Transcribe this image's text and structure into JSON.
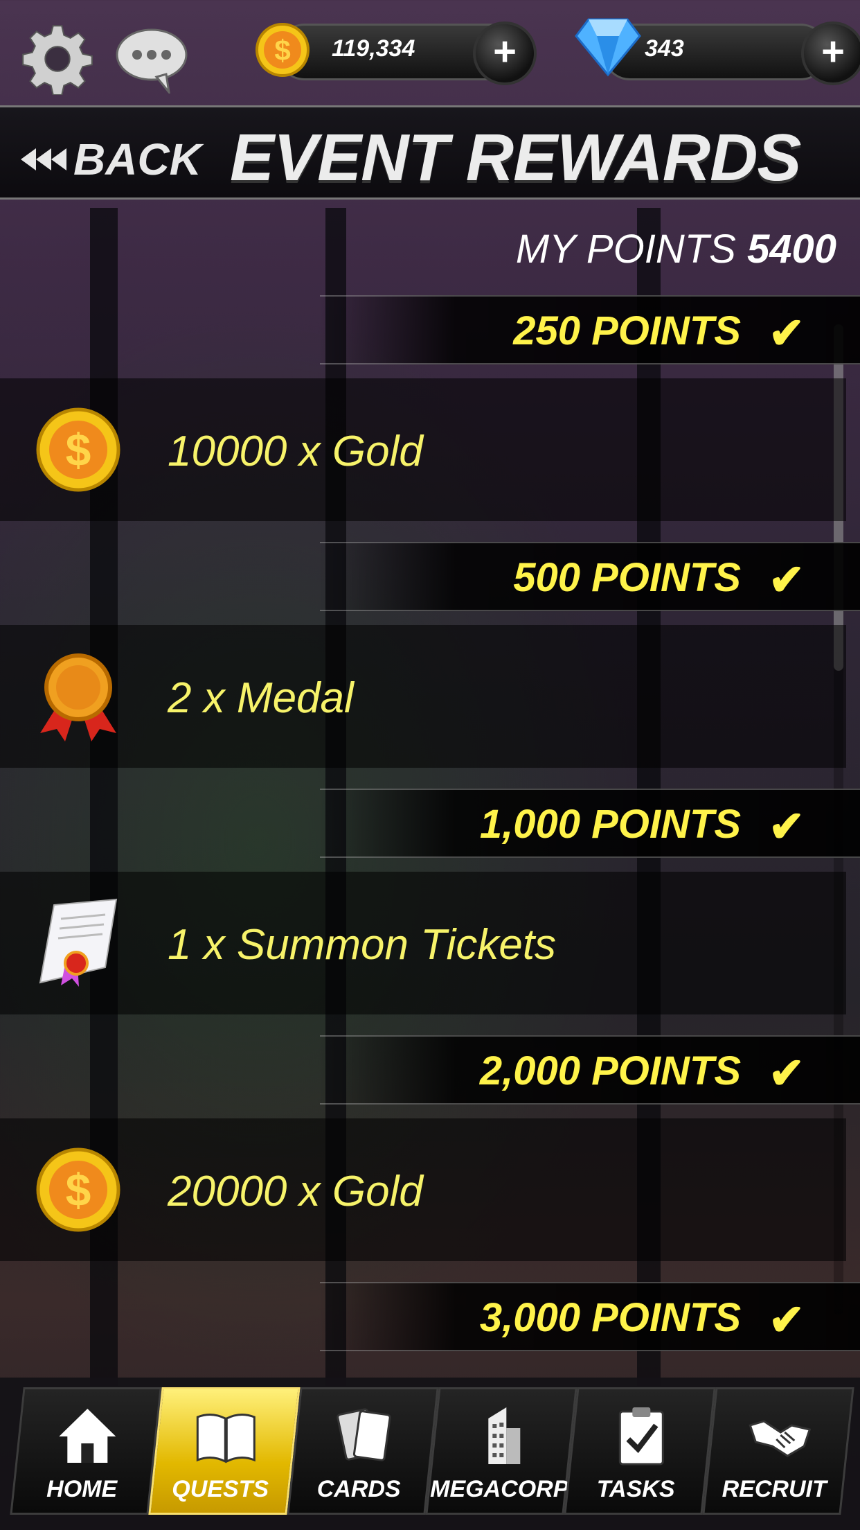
{
  "topbar": {
    "settings_icon": "gear-icon",
    "chat_icon": "chat-bubble-icon",
    "gold": {
      "icon": "gold-coin-icon",
      "value": "119,334",
      "add_label": "+"
    },
    "gems": {
      "icon": "diamond-icon",
      "value": "343",
      "add_label": "+"
    }
  },
  "header": {
    "back_label": "BACK",
    "title": "EVENT REWARDS"
  },
  "points": {
    "label": "MY POINTS",
    "value": "5400"
  },
  "tiers": [
    {
      "points": "250 POINTS",
      "claimed": true,
      "reward": "10000 x Gold",
      "icon": "gold-coin-icon"
    },
    {
      "points": "500 POINTS",
      "claimed": true,
      "reward": "2 x Medal",
      "icon": "medal-icon"
    },
    {
      "points": "1,000 POINTS",
      "claimed": true,
      "reward": "1 x Summon Tickets",
      "icon": "summon-ticket-icon"
    },
    {
      "points": "2,000 POINTS",
      "claimed": true,
      "reward": "20000 x Gold",
      "icon": "gold-coin-icon"
    },
    {
      "points": "3,000 POINTS",
      "claimed": true
    }
  ],
  "check_mark": "✔",
  "nav": [
    {
      "label": "HOME",
      "icon": "house-icon",
      "active": false
    },
    {
      "label": "QUESTS",
      "icon": "book-icon",
      "active": true
    },
    {
      "label": "CARDS",
      "icon": "cards-icon",
      "active": false
    },
    {
      "label": "MEGACORP",
      "icon": "building-icon",
      "active": false
    },
    {
      "label": "TASKS",
      "icon": "clipboard-icon",
      "active": false
    },
    {
      "label": "RECRUIT",
      "icon": "handshake-icon",
      "active": false
    }
  ],
  "colors": {
    "accent_yellow": "#fff34a",
    "reward_text": "#f7f36a",
    "nav_active": "#e2b800"
  }
}
